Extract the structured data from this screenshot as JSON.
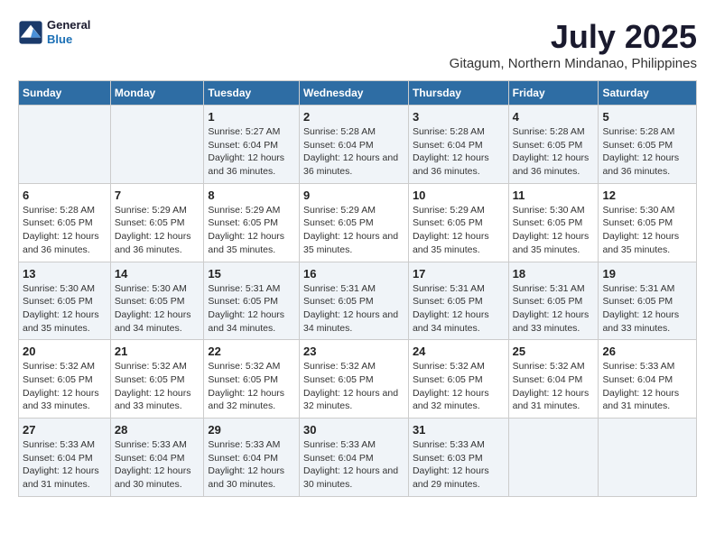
{
  "header": {
    "logo": {
      "line1": "General",
      "line2": "Blue"
    },
    "title": "July 2025",
    "subtitle": "Gitagum, Northern Mindanao, Philippines"
  },
  "days_of_week": [
    "Sunday",
    "Monday",
    "Tuesday",
    "Wednesday",
    "Thursday",
    "Friday",
    "Saturday"
  ],
  "weeks": [
    {
      "cells": [
        {
          "day": "",
          "info": ""
        },
        {
          "day": "",
          "info": ""
        },
        {
          "day": "1",
          "info": "Sunrise: 5:27 AM\nSunset: 6:04 PM\nDaylight: 12 hours and 36 minutes."
        },
        {
          "day": "2",
          "info": "Sunrise: 5:28 AM\nSunset: 6:04 PM\nDaylight: 12 hours and 36 minutes."
        },
        {
          "day": "3",
          "info": "Sunrise: 5:28 AM\nSunset: 6:04 PM\nDaylight: 12 hours and 36 minutes."
        },
        {
          "day": "4",
          "info": "Sunrise: 5:28 AM\nSunset: 6:05 PM\nDaylight: 12 hours and 36 minutes."
        },
        {
          "day": "5",
          "info": "Sunrise: 5:28 AM\nSunset: 6:05 PM\nDaylight: 12 hours and 36 minutes."
        }
      ]
    },
    {
      "cells": [
        {
          "day": "6",
          "info": "Sunrise: 5:28 AM\nSunset: 6:05 PM\nDaylight: 12 hours and 36 minutes."
        },
        {
          "day": "7",
          "info": "Sunrise: 5:29 AM\nSunset: 6:05 PM\nDaylight: 12 hours and 36 minutes."
        },
        {
          "day": "8",
          "info": "Sunrise: 5:29 AM\nSunset: 6:05 PM\nDaylight: 12 hours and 35 minutes."
        },
        {
          "day": "9",
          "info": "Sunrise: 5:29 AM\nSunset: 6:05 PM\nDaylight: 12 hours and 35 minutes."
        },
        {
          "day": "10",
          "info": "Sunrise: 5:29 AM\nSunset: 6:05 PM\nDaylight: 12 hours and 35 minutes."
        },
        {
          "day": "11",
          "info": "Sunrise: 5:30 AM\nSunset: 6:05 PM\nDaylight: 12 hours and 35 minutes."
        },
        {
          "day": "12",
          "info": "Sunrise: 5:30 AM\nSunset: 6:05 PM\nDaylight: 12 hours and 35 minutes."
        }
      ]
    },
    {
      "cells": [
        {
          "day": "13",
          "info": "Sunrise: 5:30 AM\nSunset: 6:05 PM\nDaylight: 12 hours and 35 minutes."
        },
        {
          "day": "14",
          "info": "Sunrise: 5:30 AM\nSunset: 6:05 PM\nDaylight: 12 hours and 34 minutes."
        },
        {
          "day": "15",
          "info": "Sunrise: 5:31 AM\nSunset: 6:05 PM\nDaylight: 12 hours and 34 minutes."
        },
        {
          "day": "16",
          "info": "Sunrise: 5:31 AM\nSunset: 6:05 PM\nDaylight: 12 hours and 34 minutes."
        },
        {
          "day": "17",
          "info": "Sunrise: 5:31 AM\nSunset: 6:05 PM\nDaylight: 12 hours and 34 minutes."
        },
        {
          "day": "18",
          "info": "Sunrise: 5:31 AM\nSunset: 6:05 PM\nDaylight: 12 hours and 33 minutes."
        },
        {
          "day": "19",
          "info": "Sunrise: 5:31 AM\nSunset: 6:05 PM\nDaylight: 12 hours and 33 minutes."
        }
      ]
    },
    {
      "cells": [
        {
          "day": "20",
          "info": "Sunrise: 5:32 AM\nSunset: 6:05 PM\nDaylight: 12 hours and 33 minutes."
        },
        {
          "day": "21",
          "info": "Sunrise: 5:32 AM\nSunset: 6:05 PM\nDaylight: 12 hours and 33 minutes."
        },
        {
          "day": "22",
          "info": "Sunrise: 5:32 AM\nSunset: 6:05 PM\nDaylight: 12 hours and 32 minutes."
        },
        {
          "day": "23",
          "info": "Sunrise: 5:32 AM\nSunset: 6:05 PM\nDaylight: 12 hours and 32 minutes."
        },
        {
          "day": "24",
          "info": "Sunrise: 5:32 AM\nSunset: 6:05 PM\nDaylight: 12 hours and 32 minutes."
        },
        {
          "day": "25",
          "info": "Sunrise: 5:32 AM\nSunset: 6:04 PM\nDaylight: 12 hours and 31 minutes."
        },
        {
          "day": "26",
          "info": "Sunrise: 5:33 AM\nSunset: 6:04 PM\nDaylight: 12 hours and 31 minutes."
        }
      ]
    },
    {
      "cells": [
        {
          "day": "27",
          "info": "Sunrise: 5:33 AM\nSunset: 6:04 PM\nDaylight: 12 hours and 31 minutes."
        },
        {
          "day": "28",
          "info": "Sunrise: 5:33 AM\nSunset: 6:04 PM\nDaylight: 12 hours and 30 minutes."
        },
        {
          "day": "29",
          "info": "Sunrise: 5:33 AM\nSunset: 6:04 PM\nDaylight: 12 hours and 30 minutes."
        },
        {
          "day": "30",
          "info": "Sunrise: 5:33 AM\nSunset: 6:04 PM\nDaylight: 12 hours and 30 minutes."
        },
        {
          "day": "31",
          "info": "Sunrise: 5:33 AM\nSunset: 6:03 PM\nDaylight: 12 hours and 29 minutes."
        },
        {
          "day": "",
          "info": ""
        },
        {
          "day": "",
          "info": ""
        }
      ]
    }
  ]
}
